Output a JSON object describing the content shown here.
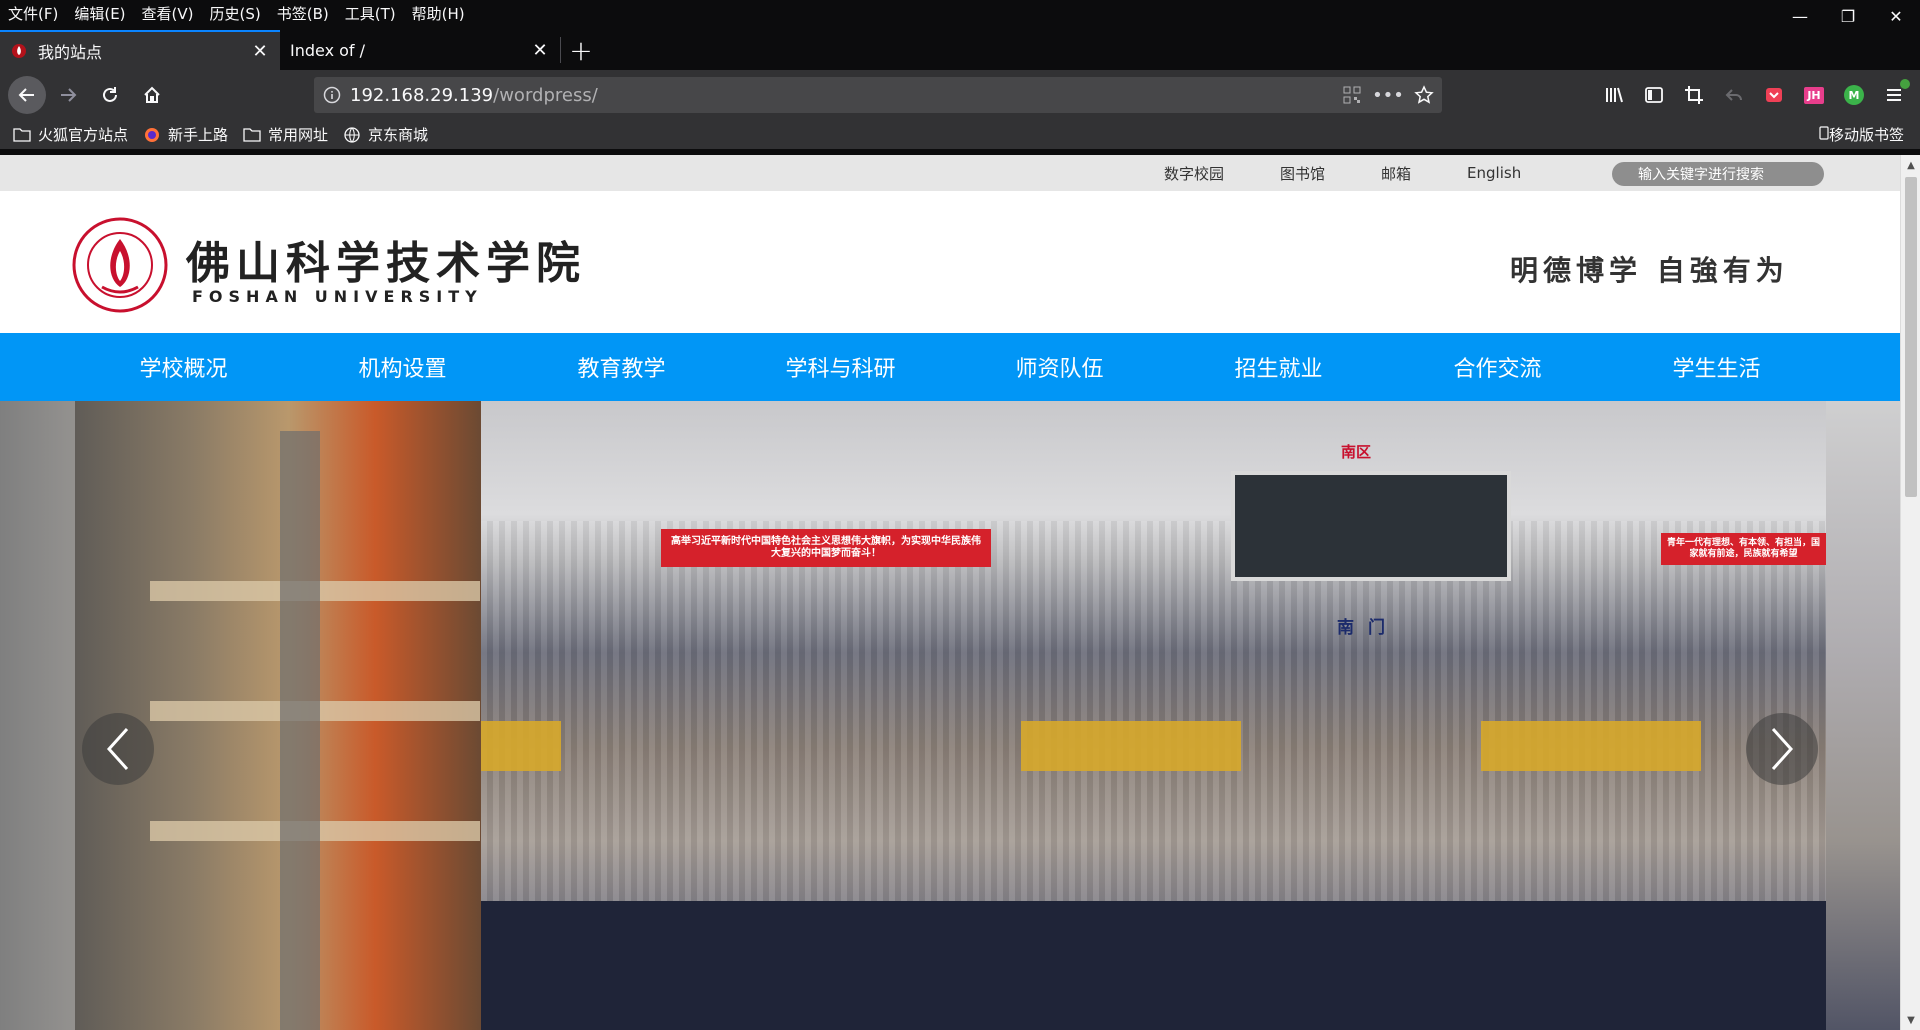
{
  "menubar": {
    "items": [
      "文件(F)",
      "编辑(E)",
      "查看(V)",
      "历史(S)",
      "书签(B)",
      "工具(T)",
      "帮助(H)"
    ]
  },
  "tabs": [
    {
      "label": "我的站点",
      "active": true
    },
    {
      "label": "Index of /",
      "active": false
    }
  ],
  "urlbar": {
    "host": "192.168.29.139",
    "path": "/wordpress/"
  },
  "bookmarks": {
    "items": [
      "火狐官方站点",
      "新手上路",
      "常用网址",
      "京东商城"
    ],
    "mobile": "移动版书签"
  },
  "toolbar": {
    "jh_badge": "JH",
    "m_badge": "M"
  },
  "site": {
    "toplinks": [
      "数字校园",
      "图书馆",
      "邮箱",
      "English"
    ],
    "search_placeholder": "输入关键字进行搜索",
    "name_cn": "佛山科学技术学院",
    "name_en": "FOSHAN UNIVERSITY",
    "motto": "明德博学 自強有为",
    "nav": [
      "学校概况",
      "机构设置",
      "教育教学",
      "学科与科研",
      "师资队伍",
      "招生就业",
      "合作交流",
      "学生生活"
    ],
    "banner": {
      "zone": "南区",
      "gate": "南门",
      "slogan_left": "高举习近平新时代中国特色社会主义思想伟大旗帜，为实现中华民族伟大复兴的中国梦而奋斗！",
      "slogan_right": "青年一代有理想、有本领、有担当，国家就有前途，民族就有希望"
    }
  },
  "colors": {
    "nav_blue": "#0196f6",
    "chrome_dark": "#0c0c0d",
    "chrome_toolbar": "#323234",
    "tab_accent": "#0a84ff"
  }
}
